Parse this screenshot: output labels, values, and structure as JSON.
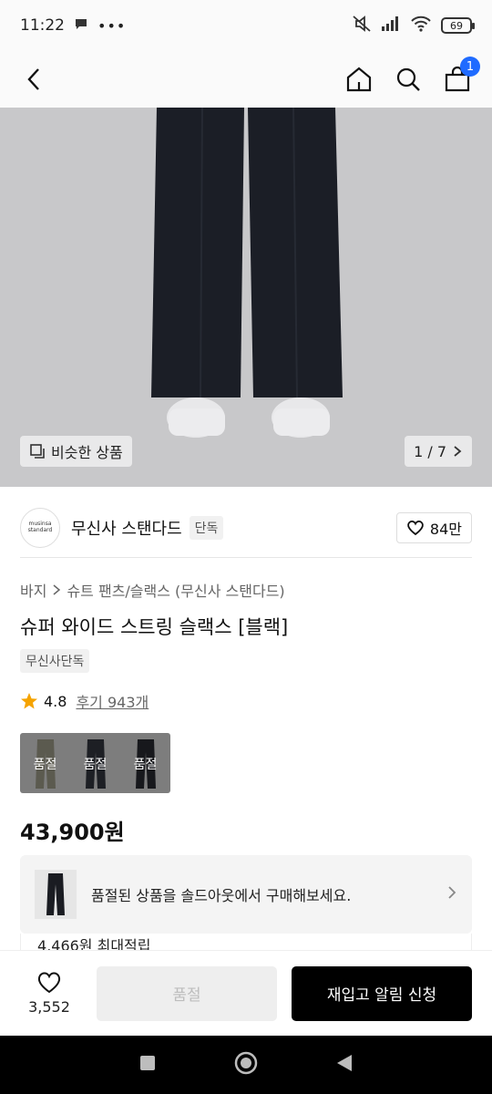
{
  "status_bar": {
    "time": "11:22",
    "battery": "69"
  },
  "product": {
    "image_counter": "1 / 7",
    "similar_label": "비슷한 상품",
    "brand": {
      "logo_line1": "musinsa",
      "logo_line2": "standard",
      "name": "무신사 스탠다드",
      "tag": "단독"
    },
    "likes": "84만",
    "breadcrumb": [
      "바지",
      "슈트 팬츠/슬랙스 (무신사 스탠다드)"
    ],
    "title": "슈퍼 와이드 스트링 슬랙스 [블랙]",
    "exclusive_tag": "무신사단독",
    "rating": "4.8",
    "reviews": "후기 943개",
    "swatches": [
      {
        "label": "품절",
        "color": "#5b5a4f"
      },
      {
        "label": "품절",
        "color": "#1d1f24"
      },
      {
        "label": "품절",
        "color": "#17181c"
      }
    ],
    "price": "43,900원",
    "resell_text": "품절된 상품을 솔드아웃에서 구매해보세요.",
    "points": "4,466원 최대적립"
  },
  "bottom_bar": {
    "wish_count": "3,552",
    "soldout_label": "품절",
    "restock_label": "재입고 알림 신청"
  },
  "cart": {
    "count": "1"
  }
}
